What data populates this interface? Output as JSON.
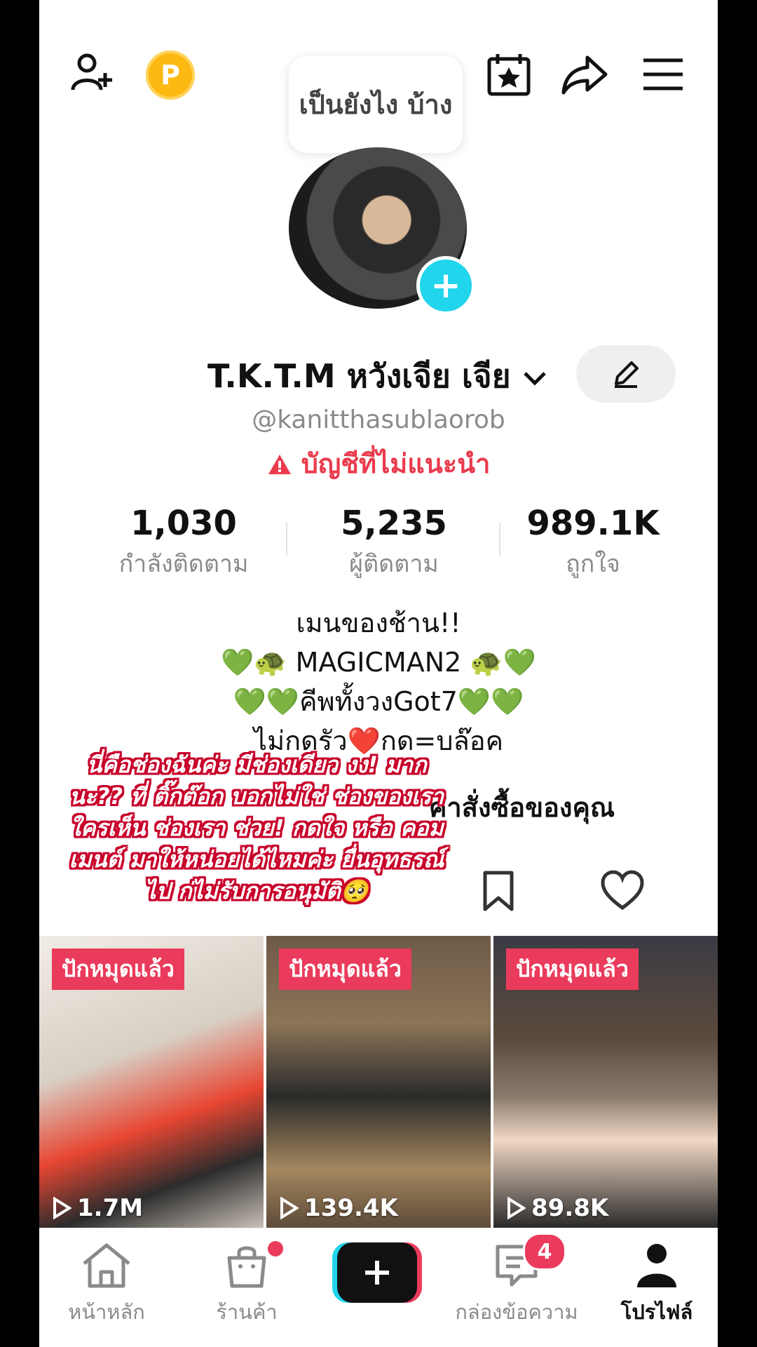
{
  "header": {
    "bubble_text": "เป็นยังไง บ้าง",
    "coin_label": "P"
  },
  "profile": {
    "display_name": "T.K.T.M หวังเจีย เจีย",
    "handle": "@kanitthasublaorob",
    "warning_text": "บัญชีที่ไม่แนะนำ",
    "stats": [
      {
        "value": "1,030",
        "label": "กำลังติดตาม"
      },
      {
        "value": "5,235",
        "label": "ผู้ติดตาม"
      },
      {
        "value": "989.1K",
        "label": "ถูกใจ"
      }
    ],
    "bio": [
      "เมนของช้าน!!",
      "💚🐢 MAGICMAN2 🐢💚",
      "💚💚คีพทั้งวงGot7💚💚",
      "ไม่กดรัว❤️กด=บล๊อค"
    ]
  },
  "orders_label": "คำสั่งซื้อของคุณ",
  "overlay_caption": "นี่คือช่องฉันค่ะ มีช่องเดียว งง! มากนะ?? ที่ ติ๊กต๊อก บอกไม่ใช่ ช่องของเรา ใครเห็น ช่องเรา ช่วย! กดใจ หรือ คอมเมนต์ มาให้หน่อยได้ไหมค่ะ ยื่นอุทธรณ์ ไป ก่ไม่รับการอนุมัติ🥺",
  "videos": [
    {
      "badge": "ปักหมุดแล้ว",
      "views": "1.7M"
    },
    {
      "badge": "ปักหมุดแล้ว",
      "views": "139.4K"
    },
    {
      "badge": "ปักหมุดแล้ว",
      "views": "89.8K"
    }
  ],
  "nav": {
    "home": "หน้าหลัก",
    "shop": "ร้านค้า",
    "inbox": "กล่องข้อความ",
    "inbox_badge": "4",
    "profile": "โปรไฟล์"
  },
  "colors": {
    "accent_red": "#EA3B5C",
    "accent_cyan": "#20D5EC",
    "coin": "#FDB812"
  }
}
